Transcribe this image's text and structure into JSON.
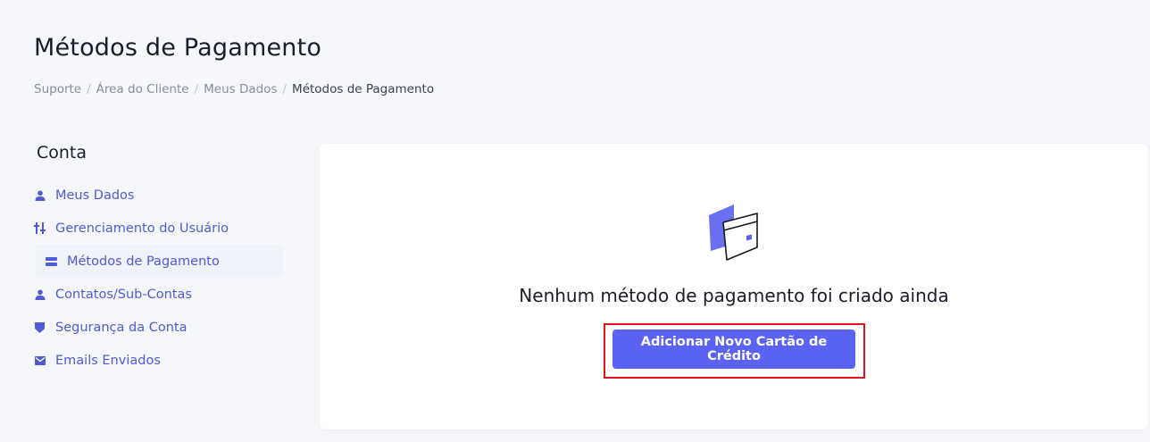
{
  "header": {
    "title": "Métodos de Pagamento",
    "breadcrumb": [
      {
        "label": "Suporte"
      },
      {
        "label": "Área do Cliente"
      },
      {
        "label": "Meus Dados"
      },
      {
        "label": "Métodos de Pagamento"
      }
    ],
    "breadcrumb_separator": "/"
  },
  "sidebar": {
    "title": "Conta",
    "items": [
      {
        "label": "Meus Dados",
        "icon": "user-icon"
      },
      {
        "label": "Gerenciamento do Usuário",
        "icon": "sliders-icon"
      },
      {
        "label": "Métodos de Pagamento",
        "icon": "card-icon",
        "active": true
      },
      {
        "label": "Contatos/Sub-Contas",
        "icon": "user-icon"
      },
      {
        "label": "Segurança da Conta",
        "icon": "shield-icon"
      },
      {
        "label": "Emails Enviados",
        "icon": "mail-icon"
      }
    ]
  },
  "main": {
    "empty_message": "Nenhum método de pagamento foi criado ainda",
    "add_button_label": "Adicionar Novo Cartão de Crédito",
    "illustration_icon": "credit-card-illustration-icon"
  },
  "colors": {
    "accent": "#5b63f5",
    "link": "#4f5bd5",
    "highlight_border": "#e0141b",
    "background": "#f6f7fb"
  }
}
